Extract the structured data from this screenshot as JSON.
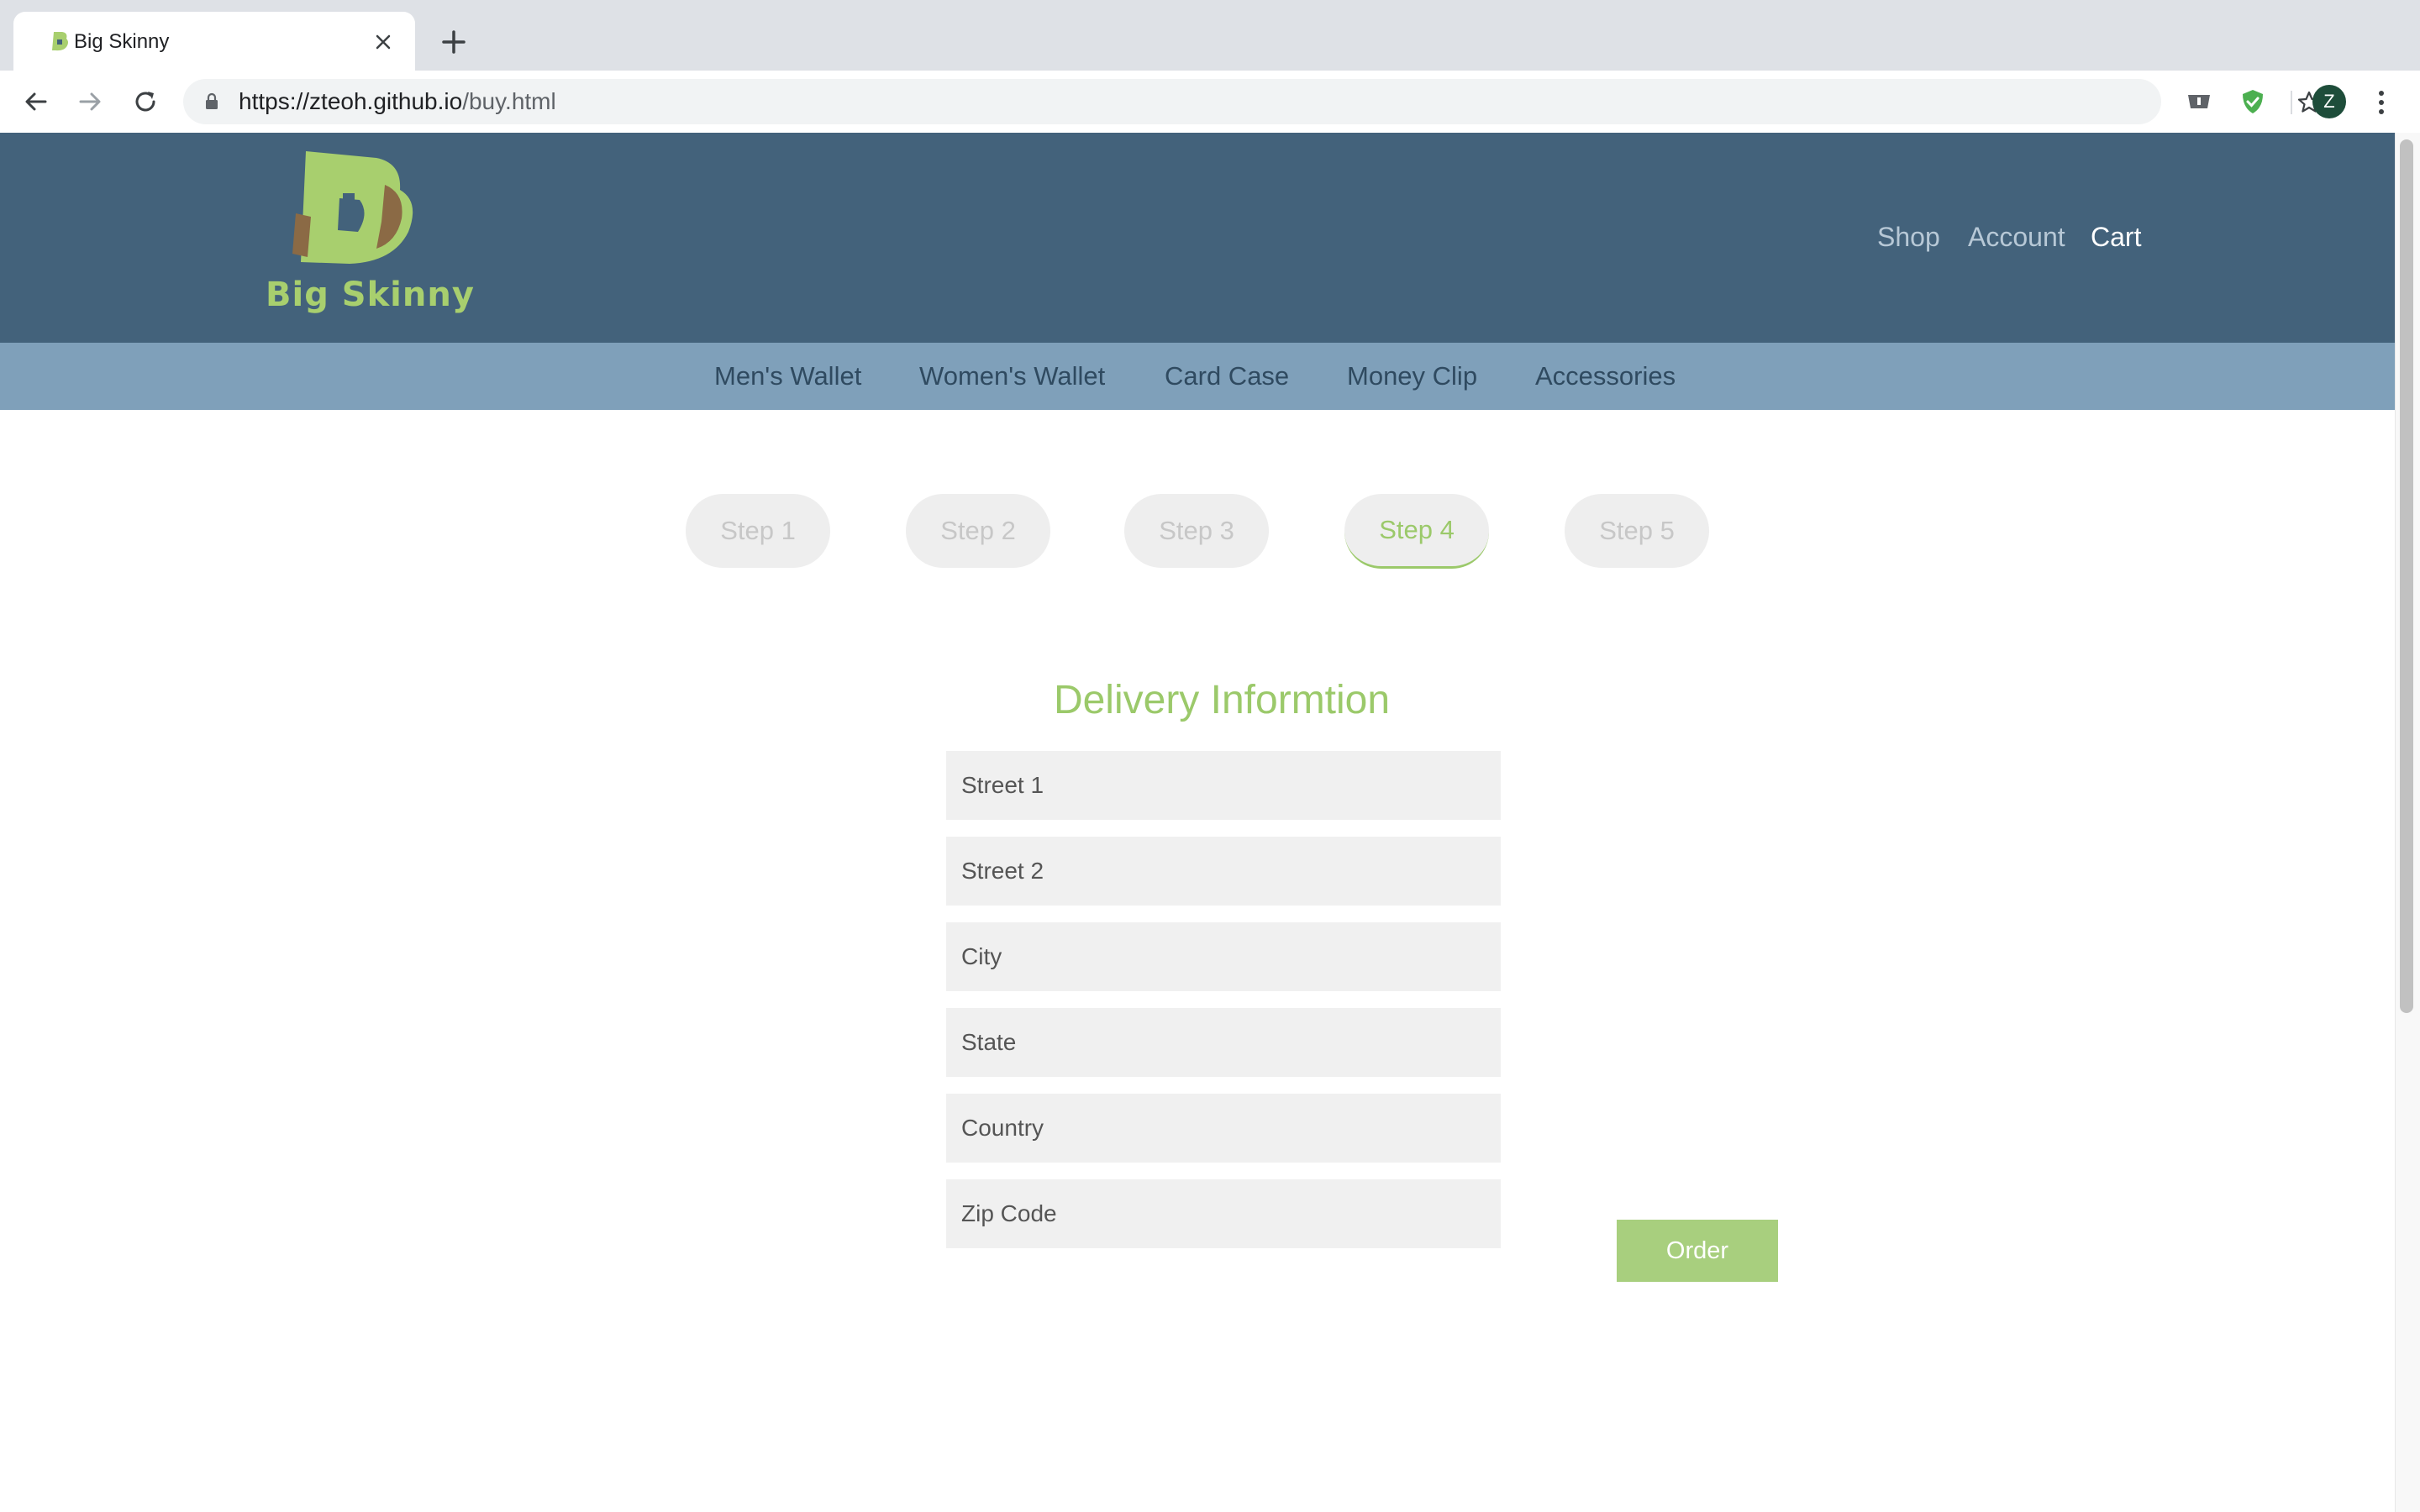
{
  "browser": {
    "tab_title": "Big Skinny",
    "url_host": "https://zteoh.github.io",
    "url_path": "/buy.html",
    "avatar_letter": "Z"
  },
  "site": {
    "brand": "Big Skinny",
    "top_nav": {
      "shop": "Shop",
      "account": "Account",
      "cart": "Cart"
    },
    "categories": [
      "Men's Wallet",
      "Women's Wallet",
      "Card Case",
      "Money Clip",
      "Accessories"
    ],
    "steps": [
      "Step 1",
      "Step 2",
      "Step 3",
      "Step 4",
      "Step 5"
    ],
    "active_step": "Step 4",
    "colors": {
      "header": "#43627b",
      "subnav": "#7fa0ba",
      "accent": "#9bc96a"
    }
  },
  "form": {
    "title": "Delivery Informtion",
    "placeholders": {
      "street1": "Street 1",
      "street2": "Street 2",
      "city": "City",
      "state": "State",
      "country": "Country",
      "zip": "Zip Code"
    },
    "order_label": "Order"
  },
  "icons": [
    "favicon-icon",
    "close-icon",
    "plus-icon",
    "back-icon",
    "forward-icon",
    "reload-icon",
    "lock-icon",
    "star-icon",
    "extension-icon",
    "shield-icon",
    "more-icon"
  ]
}
